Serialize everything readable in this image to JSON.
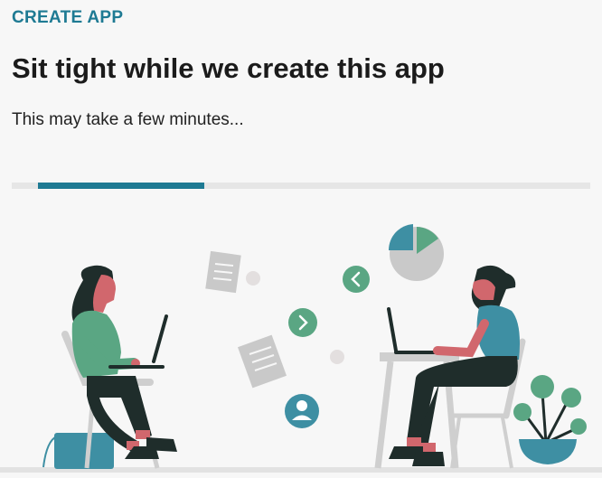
{
  "header": {
    "eyebrow": "CREATE APP",
    "title": "Sit tight while we create this app",
    "subtitle": "This may take a few minutes..."
  },
  "progress": {
    "start": 0.045,
    "end": 0.333
  },
  "colors": {
    "accent": "#1e7a93",
    "track": "#e6e6e6",
    "green": "#5aa683",
    "teal": "#3e8fa3",
    "skin": "#d1676d",
    "dark": "#1f2d2b",
    "grey": "#c9c9c9"
  },
  "illustration": {
    "icons": [
      "document-icon",
      "chevron-left-icon",
      "chevron-right-icon",
      "pie-chart-icon",
      "user-icon",
      "plant-icon",
      "laptop-icon"
    ]
  }
}
